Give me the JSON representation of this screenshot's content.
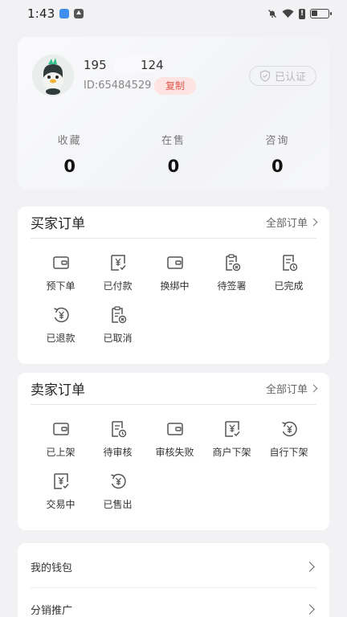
{
  "status_bar": {
    "time": "1:43"
  },
  "profile": {
    "username_prefix": "195",
    "username_suffix": "124",
    "user_id": "ID:65484529",
    "copy_label": "复制",
    "verified_label": "已认证",
    "stats": [
      {
        "label": "收藏",
        "value": "0"
      },
      {
        "label": "在售",
        "value": "0"
      },
      {
        "label": "咨询",
        "value": "0"
      }
    ]
  },
  "buyer_orders": {
    "title": "买家订单",
    "all_label": "全部订单",
    "items": [
      {
        "label": "预下单",
        "icon": "wallet-icon"
      },
      {
        "label": "已付款",
        "icon": "yuan-check-icon"
      },
      {
        "label": "换绑中",
        "icon": "wallet-icon"
      },
      {
        "label": "待签署",
        "icon": "clipboard-x-icon"
      },
      {
        "label": "已完成",
        "icon": "document-clock-icon"
      },
      {
        "label": "已退款",
        "icon": "yuan-refresh-icon"
      },
      {
        "label": "已取消",
        "icon": "clipboard-x-icon"
      }
    ]
  },
  "seller_orders": {
    "title": "卖家订单",
    "all_label": "全部订单",
    "items": [
      {
        "label": "已上架",
        "icon": "wallet-icon"
      },
      {
        "label": "待审核",
        "icon": "document-clock-icon"
      },
      {
        "label": "审核失败",
        "icon": "wallet-icon"
      },
      {
        "label": "商户下架",
        "icon": "yuan-check-icon"
      },
      {
        "label": "自行下架",
        "icon": "yuan-refresh-icon"
      },
      {
        "label": "交易中",
        "icon": "yuan-check-icon"
      },
      {
        "label": "已售出",
        "icon": "yuan-refresh-icon"
      }
    ]
  },
  "menu": {
    "wallet_label": "我的钱包",
    "distribution_label": "分销推广"
  }
}
